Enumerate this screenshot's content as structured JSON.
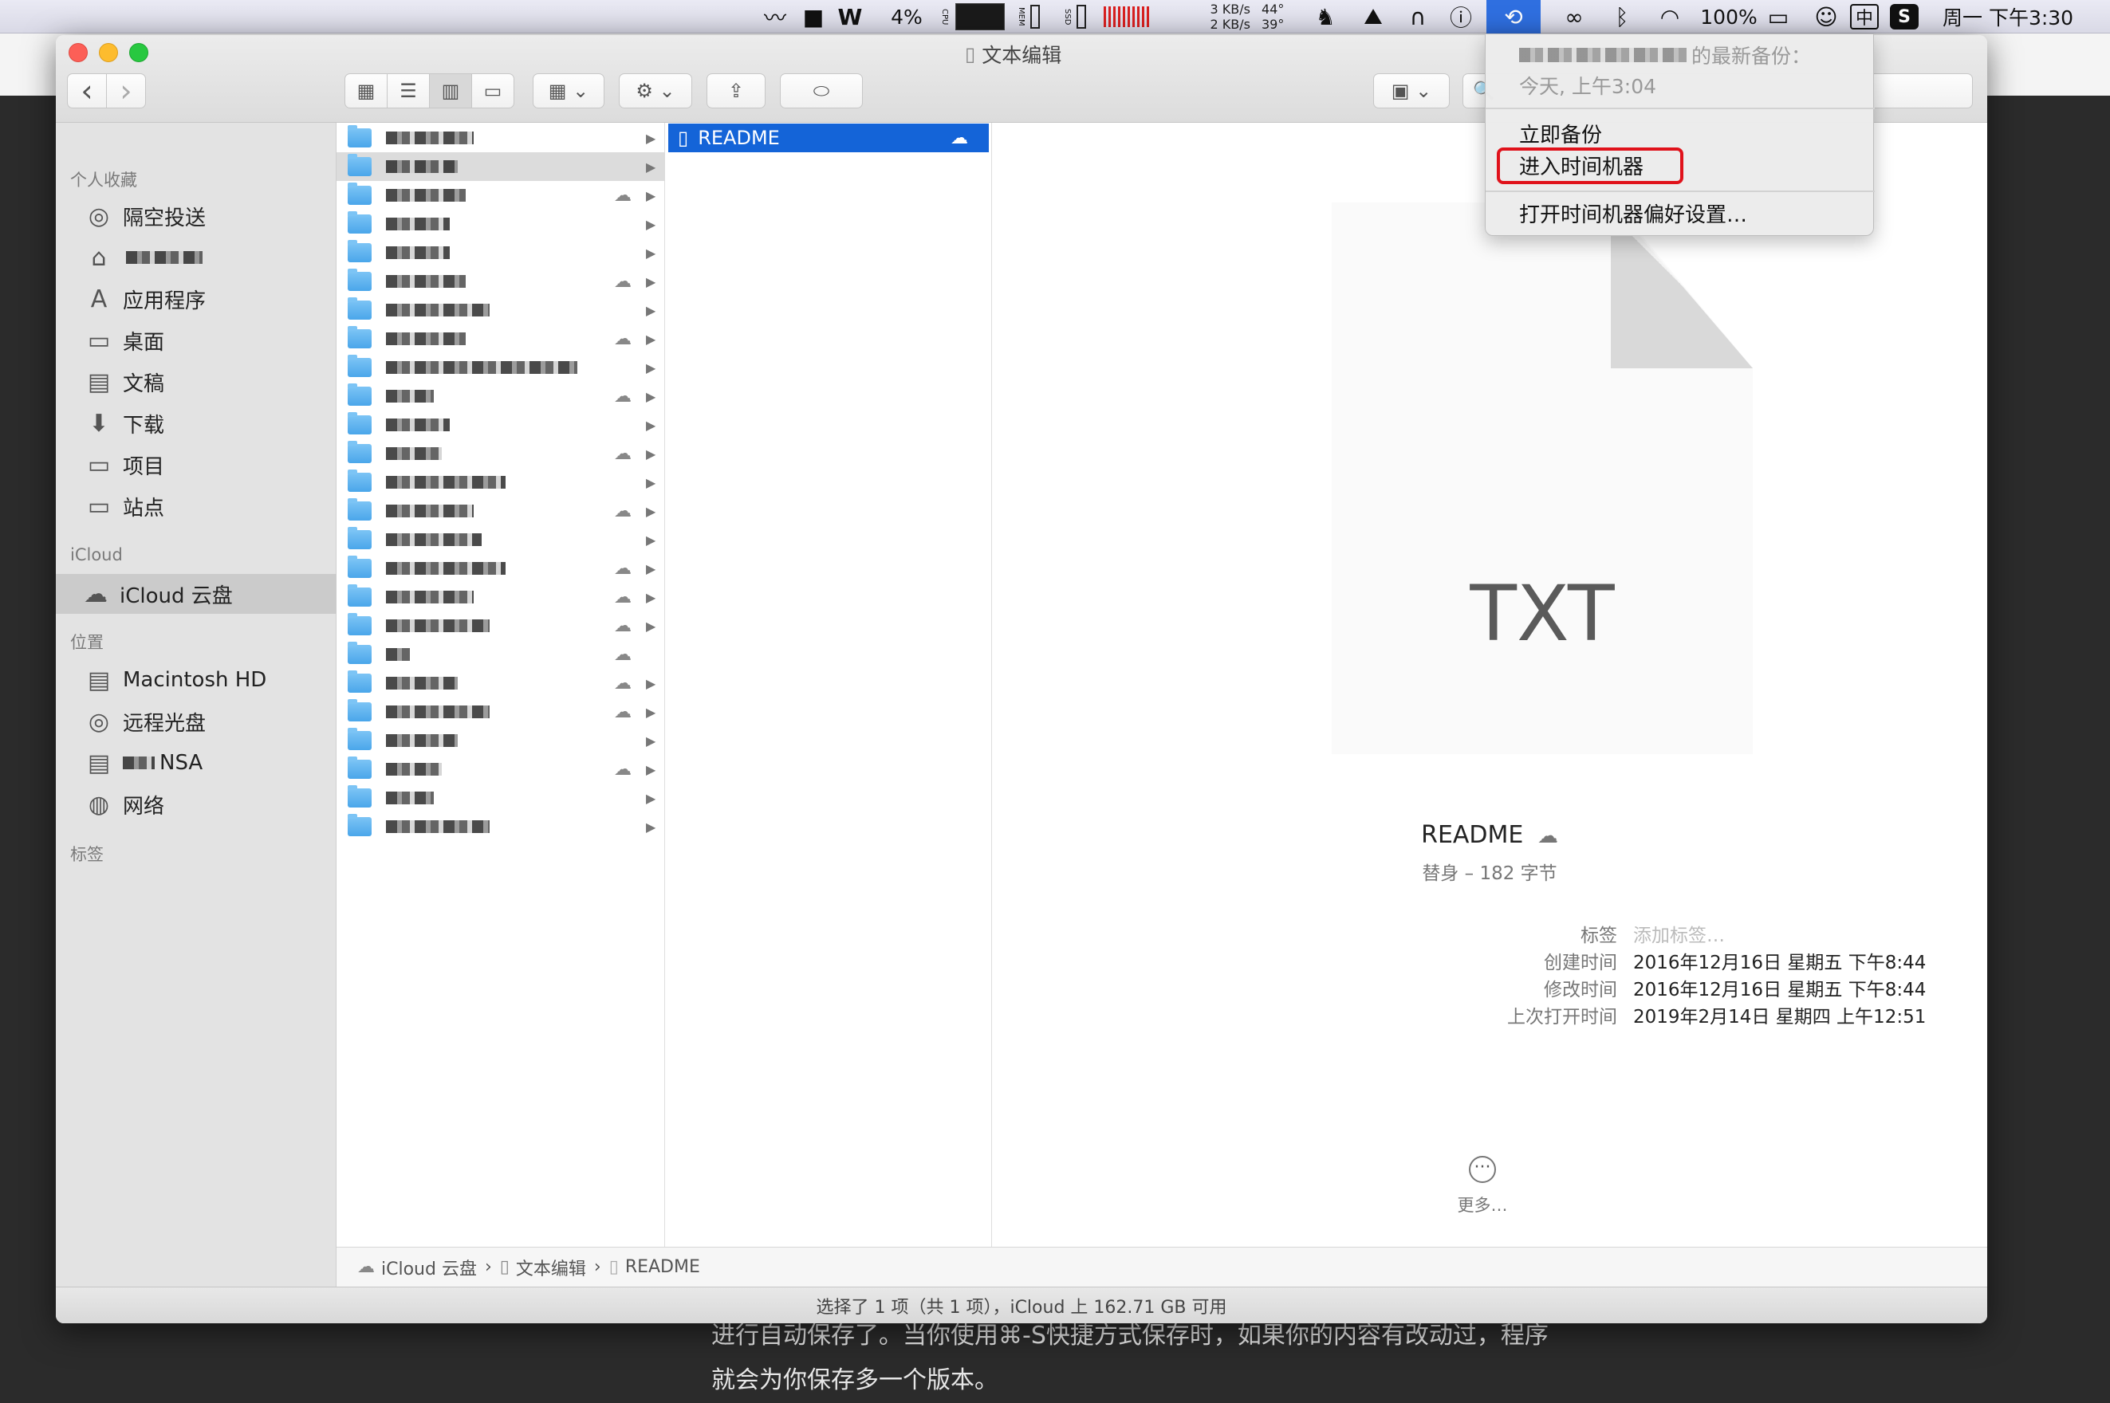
{
  "menubar": {
    "items": [
      {
        "name": "rss-feed-icon",
        "label": "〰"
      },
      {
        "name": "bookmark-icon",
        "label": "■"
      },
      {
        "name": "w-app-icon",
        "label": "W"
      },
      {
        "name": "cpu-percent",
        "label": "4%"
      },
      {
        "name": "cpu-label",
        "label": "CPU"
      },
      {
        "name": "mem-label",
        "label": "MEM"
      },
      {
        "name": "ssd-label",
        "label": "SSD"
      },
      {
        "name": "net-up",
        "label": "3 KB/s"
      },
      {
        "name": "net-down",
        "label": "2 KB/s"
      },
      {
        "name": "temp-1",
        "label": "44°"
      },
      {
        "name": "temp-2",
        "label": "39°"
      },
      {
        "name": "qq-icon",
        "label": "♞"
      },
      {
        "name": "display-icon",
        "label": "⛰"
      },
      {
        "name": "headphones-icon",
        "label": "∩"
      },
      {
        "name": "info-icon",
        "label": "ⓘ"
      },
      {
        "name": "time-machine-icon",
        "label": "⟲"
      },
      {
        "name": "creative-cloud-icon",
        "label": "∞"
      },
      {
        "name": "bluetooth-icon",
        "label": "ᛒ"
      },
      {
        "name": "wifi-icon",
        "label": "◠"
      },
      {
        "name": "battery-percent",
        "label": "100%"
      },
      {
        "name": "battery-icon",
        "label": "▭"
      },
      {
        "name": "emoji-icon",
        "label": "☺"
      },
      {
        "name": "input-method",
        "label": "中"
      },
      {
        "name": "sogou-icon",
        "label": "S"
      },
      {
        "name": "clock",
        "label": "周一 下午3:30"
      }
    ]
  },
  "window": {
    "title": "文本编辑",
    "toolbar": {
      "back": "‹",
      "forward": "›",
      "view_icons": "▦",
      "view_list": "☰",
      "view_columns": "▥",
      "view_gallery": "▭",
      "group": "▦ ⌄",
      "action": "⚙ ⌄",
      "share": "⇪",
      "tag": "⬭",
      "dropbox": "▣ ⌄",
      "search": "🔍"
    },
    "sidebar": {
      "favorites_header": "个人收藏",
      "favorites": [
        {
          "name": "sidebar-item-airdrop",
          "icon": "◎",
          "label": "隔空投送"
        },
        {
          "name": "sidebar-item-home",
          "icon": "⌂",
          "label": ""
        },
        {
          "name": "sidebar-item-applications",
          "icon": "A",
          "label": "应用程序"
        },
        {
          "name": "sidebar-item-desktop",
          "icon": "▭",
          "label": "桌面"
        },
        {
          "name": "sidebar-item-documents",
          "icon": "▤",
          "label": "文稿"
        },
        {
          "name": "sidebar-item-downloads",
          "icon": "⬇",
          "label": "下载"
        },
        {
          "name": "sidebar-item-projects",
          "icon": "▭",
          "label": "项目"
        },
        {
          "name": "sidebar-item-sites",
          "icon": "▭",
          "label": "站点"
        }
      ],
      "icloud_header": "iCloud",
      "icloud": [
        {
          "name": "sidebar-item-icloud-drive",
          "icon": "☁",
          "label": "iCloud 云盘"
        }
      ],
      "locations_header": "位置",
      "locations": [
        {
          "name": "sidebar-item-macintosh-hd",
          "icon": "▤",
          "label": "Macintosh HD"
        },
        {
          "name": "sidebar-item-remote-disc",
          "icon": "◎",
          "label": "远程光盘"
        },
        {
          "name": "sidebar-item-nsa",
          "icon": "▤",
          "label": "NSA"
        },
        {
          "name": "sidebar-item-network",
          "icon": "◍",
          "label": "网络"
        }
      ],
      "tags_header": "标签"
    },
    "column2": {
      "selected_file": "README"
    },
    "preview": {
      "extension": "TXT",
      "filename": "README",
      "subtitle": "替身 – 182 字节",
      "meta": [
        {
          "label": "标签",
          "value": "添加标签…",
          "placeholder": true
        },
        {
          "label": "创建时间",
          "value": "2016年12月16日 星期五 下午8:44"
        },
        {
          "label": "修改时间",
          "value": "2016年12月16日 星期五 下午8:44"
        },
        {
          "label": "上次打开时间",
          "value": "2019年2月14日 星期四 上午12:51"
        }
      ],
      "more_label": "更多…"
    },
    "pathbar": {
      "items": [
        "iCloud 云盘",
        "文本编辑",
        "README"
      ]
    },
    "status": "选择了 1 项（共 1 项），iCloud 上 162.71 GB 可用"
  },
  "time_machine_menu": {
    "latest_backup_label": "的最新备份：",
    "latest_backup_time": "今天, 上午3:04",
    "back_up_now": "立即备份",
    "enter_time_machine": "进入时间机器",
    "open_preferences": "打开时间机器偏好设置…"
  },
  "background_text": {
    "line1": "进行自动保存了。当你使用⌘-S快捷方式保存时，如果你的内容有改动过，程序",
    "line2": "就会为你保存多一个版本。"
  },
  "colors": {
    "selection_blue": "#1464d8",
    "highlight_red": "#e0121b",
    "folder_blue": "#5ab0ee"
  }
}
